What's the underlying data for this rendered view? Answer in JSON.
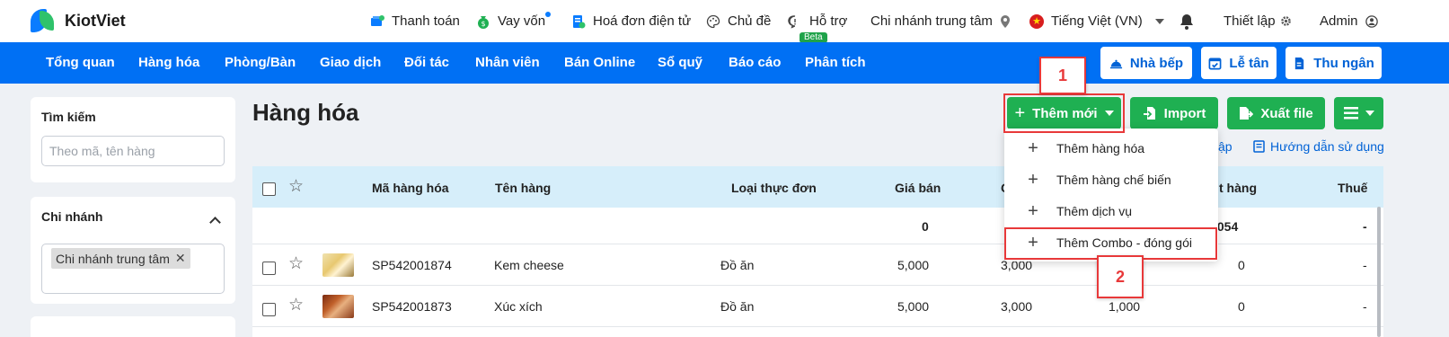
{
  "app": {
    "brand": "KiotViet"
  },
  "topnav": {
    "payment": "Thanh toán",
    "loan": "Vay vốn",
    "einvoice": "Hoá đơn điện tử",
    "theme": "Chủ đề",
    "support": "Hỗ trợ",
    "beta": "Beta",
    "branch": "Chi nhánh trung tâm",
    "language": "Tiếng Việt (VN)",
    "settings": "Thiết lập",
    "user": "Admin"
  },
  "menu": {
    "items": [
      "Tổng quan",
      "Hàng hóa",
      "Phòng/Bàn",
      "Giao dịch",
      "Đối tác",
      "Nhân viên",
      "Bán Online",
      "Sổ quỹ",
      "Báo cáo",
      "Phân tích"
    ],
    "kitchen": "Nhà bếp",
    "reception": "Lễ tân",
    "cashier": "Thu ngân"
  },
  "sidebar": {
    "search_title": "Tìm kiếm",
    "search_placeholder": "Theo mã, tên hàng",
    "branch_title": "Chi nhánh",
    "branch_tag": "Chi nhánh trung tâm"
  },
  "main": {
    "title": "Hàng hóa",
    "add_new": "Thêm mới",
    "import": "Import",
    "export": "Xuất file",
    "link_partial": "ập",
    "guide": "Hướng dẫn sử dụng"
  },
  "dropdown": {
    "items": [
      "Thêm hàng hóa",
      "Thêm hàng chế biến",
      "Thêm dịch vụ",
      "Thêm Combo - đóng gói"
    ]
  },
  "table": {
    "headers": {
      "code": "Mã hàng hóa",
      "name": "Tên hàng",
      "menu_type": "Loại thực đơn",
      "price": "Giá bán",
      "cost_partial": "G",
      "order_partial": "t hàng",
      "tax": "Thuế"
    },
    "summary": {
      "price": "0",
      "order": ",054",
      "tax": "-"
    },
    "rows": [
      {
        "code": "SP542001874",
        "name": "Kem cheese",
        "menu_type": "Đồ ăn",
        "price": "5,000",
        "cost": "3,000",
        "stock": "",
        "order": "0",
        "tax": "-"
      },
      {
        "code": "SP542001873",
        "name": "Xúc xích",
        "menu_type": "Đồ ăn",
        "price": "5,000",
        "cost": "3,000",
        "stock": "1,000",
        "order": "0",
        "tax": "-"
      }
    ]
  },
  "callouts": {
    "one": "1",
    "two": "2"
  },
  "colors": {
    "primary": "#0070f4",
    "green": "#1fb052",
    "annotation": "#e8393a",
    "header_bg": "#d6eefa"
  }
}
